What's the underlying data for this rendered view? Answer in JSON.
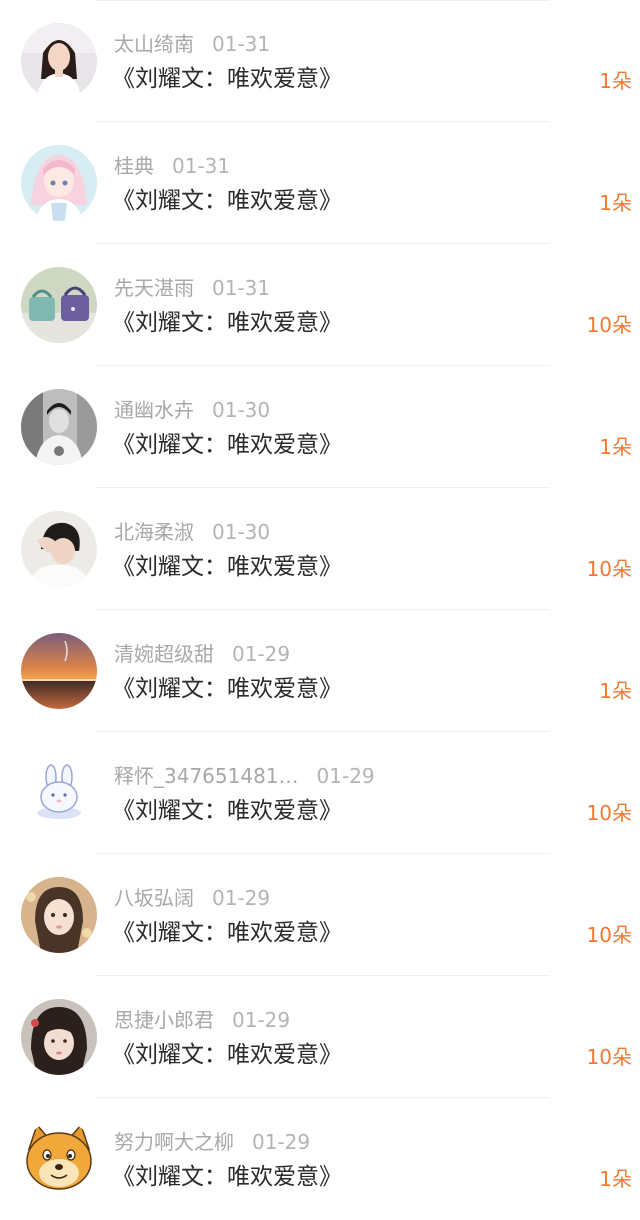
{
  "accent_color": "#f07a34",
  "items": [
    {
      "name": "太山绮南",
      "date": "01-31",
      "title": "《刘耀文：唯欢爱意》",
      "count": "1朵",
      "avatar": "avatar-photo-girl-white-shirt"
    },
    {
      "name": "桂典",
      "date": "01-31",
      "title": "《刘耀文：唯欢爱意》",
      "count": "1朵",
      "avatar": "avatar-anime-girl-pink"
    },
    {
      "name": "先天湛雨",
      "date": "01-31",
      "title": "《刘耀文：唯欢爱意》",
      "count": "10朵",
      "avatar": "avatar-photo-bags"
    },
    {
      "name": "通幽水卉",
      "date": "01-30",
      "title": "《刘耀文：唯欢爱意》",
      "count": "1朵",
      "avatar": "avatar-photo-bw-boy"
    },
    {
      "name": "北海柔淑",
      "date": "01-30",
      "title": "《刘耀文：唯欢爱意》",
      "count": "10朵",
      "avatar": "avatar-photo-hand-on-head"
    },
    {
      "name": "清婉超级甜",
      "date": "01-29",
      "title": "《刘耀文：唯欢爱意》",
      "count": "1朵",
      "avatar": "avatar-photo-sunset"
    },
    {
      "name": "释怀_347651481…",
      "date": "01-29",
      "title": "《刘耀文：唯欢爱意》",
      "count": "10朵",
      "avatar": "avatar-cartoon-bunny"
    },
    {
      "name": "八坂弘阔",
      "date": "01-29",
      "title": "《刘耀文：唯欢爱意》",
      "count": "10朵",
      "avatar": "avatar-photo-girl-face"
    },
    {
      "name": "思捷小郎君",
      "date": "01-29",
      "title": "《刘耀文：唯欢爱意》",
      "count": "10朵",
      "avatar": "avatar-photo-girl-bangs"
    },
    {
      "name": "努力啊大之柳",
      "date": "01-29",
      "title": "《刘耀文：唯欢爱意》",
      "count": "1朵",
      "avatar": "avatar-cartoon-doge"
    }
  ]
}
